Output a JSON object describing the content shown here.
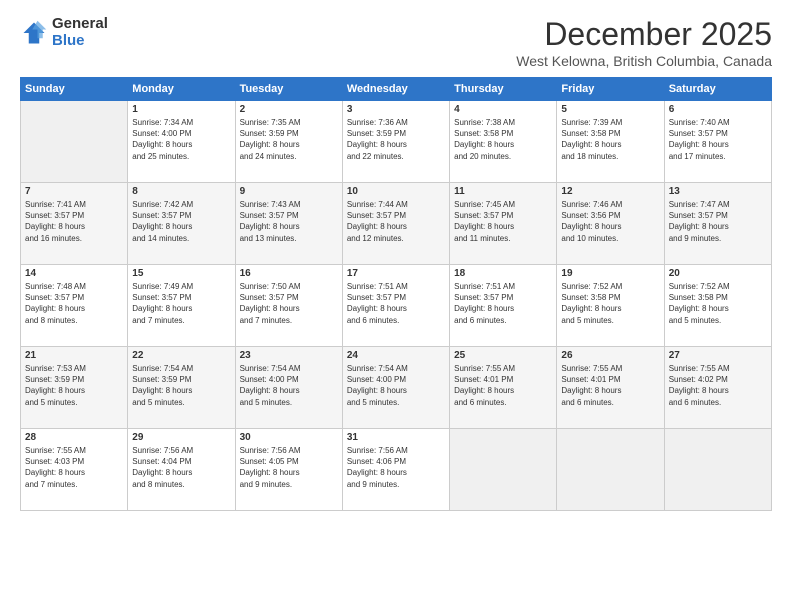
{
  "logo": {
    "general": "General",
    "blue": "Blue"
  },
  "header": {
    "month": "December 2025",
    "location": "West Kelowna, British Columbia, Canada"
  },
  "weekdays": [
    "Sunday",
    "Monday",
    "Tuesday",
    "Wednesday",
    "Thursday",
    "Friday",
    "Saturday"
  ],
  "weeks": [
    [
      {
        "day": "",
        "info": ""
      },
      {
        "day": "1",
        "info": "Sunrise: 7:34 AM\nSunset: 4:00 PM\nDaylight: 8 hours\nand 25 minutes."
      },
      {
        "day": "2",
        "info": "Sunrise: 7:35 AM\nSunset: 3:59 PM\nDaylight: 8 hours\nand 24 minutes."
      },
      {
        "day": "3",
        "info": "Sunrise: 7:36 AM\nSunset: 3:59 PM\nDaylight: 8 hours\nand 22 minutes."
      },
      {
        "day": "4",
        "info": "Sunrise: 7:38 AM\nSunset: 3:58 PM\nDaylight: 8 hours\nand 20 minutes."
      },
      {
        "day": "5",
        "info": "Sunrise: 7:39 AM\nSunset: 3:58 PM\nDaylight: 8 hours\nand 18 minutes."
      },
      {
        "day": "6",
        "info": "Sunrise: 7:40 AM\nSunset: 3:57 PM\nDaylight: 8 hours\nand 17 minutes."
      }
    ],
    [
      {
        "day": "7",
        "info": "Sunrise: 7:41 AM\nSunset: 3:57 PM\nDaylight: 8 hours\nand 16 minutes."
      },
      {
        "day": "8",
        "info": "Sunrise: 7:42 AM\nSunset: 3:57 PM\nDaylight: 8 hours\nand 14 minutes."
      },
      {
        "day": "9",
        "info": "Sunrise: 7:43 AM\nSunset: 3:57 PM\nDaylight: 8 hours\nand 13 minutes."
      },
      {
        "day": "10",
        "info": "Sunrise: 7:44 AM\nSunset: 3:57 PM\nDaylight: 8 hours\nand 12 minutes."
      },
      {
        "day": "11",
        "info": "Sunrise: 7:45 AM\nSunset: 3:57 PM\nDaylight: 8 hours\nand 11 minutes."
      },
      {
        "day": "12",
        "info": "Sunrise: 7:46 AM\nSunset: 3:56 PM\nDaylight: 8 hours\nand 10 minutes."
      },
      {
        "day": "13",
        "info": "Sunrise: 7:47 AM\nSunset: 3:57 PM\nDaylight: 8 hours\nand 9 minutes."
      }
    ],
    [
      {
        "day": "14",
        "info": "Sunrise: 7:48 AM\nSunset: 3:57 PM\nDaylight: 8 hours\nand 8 minutes."
      },
      {
        "day": "15",
        "info": "Sunrise: 7:49 AM\nSunset: 3:57 PM\nDaylight: 8 hours\nand 7 minutes."
      },
      {
        "day": "16",
        "info": "Sunrise: 7:50 AM\nSunset: 3:57 PM\nDaylight: 8 hours\nand 7 minutes."
      },
      {
        "day": "17",
        "info": "Sunrise: 7:51 AM\nSunset: 3:57 PM\nDaylight: 8 hours\nand 6 minutes."
      },
      {
        "day": "18",
        "info": "Sunrise: 7:51 AM\nSunset: 3:57 PM\nDaylight: 8 hours\nand 6 minutes."
      },
      {
        "day": "19",
        "info": "Sunrise: 7:52 AM\nSunset: 3:58 PM\nDaylight: 8 hours\nand 5 minutes."
      },
      {
        "day": "20",
        "info": "Sunrise: 7:52 AM\nSunset: 3:58 PM\nDaylight: 8 hours\nand 5 minutes."
      }
    ],
    [
      {
        "day": "21",
        "info": "Sunrise: 7:53 AM\nSunset: 3:59 PM\nDaylight: 8 hours\nand 5 minutes."
      },
      {
        "day": "22",
        "info": "Sunrise: 7:54 AM\nSunset: 3:59 PM\nDaylight: 8 hours\nand 5 minutes."
      },
      {
        "day": "23",
        "info": "Sunrise: 7:54 AM\nSunset: 4:00 PM\nDaylight: 8 hours\nand 5 minutes."
      },
      {
        "day": "24",
        "info": "Sunrise: 7:54 AM\nSunset: 4:00 PM\nDaylight: 8 hours\nand 5 minutes."
      },
      {
        "day": "25",
        "info": "Sunrise: 7:55 AM\nSunset: 4:01 PM\nDaylight: 8 hours\nand 6 minutes."
      },
      {
        "day": "26",
        "info": "Sunrise: 7:55 AM\nSunset: 4:01 PM\nDaylight: 8 hours\nand 6 minutes."
      },
      {
        "day": "27",
        "info": "Sunrise: 7:55 AM\nSunset: 4:02 PM\nDaylight: 8 hours\nand 6 minutes."
      }
    ],
    [
      {
        "day": "28",
        "info": "Sunrise: 7:55 AM\nSunset: 4:03 PM\nDaylight: 8 hours\nand 7 minutes."
      },
      {
        "day": "29",
        "info": "Sunrise: 7:56 AM\nSunset: 4:04 PM\nDaylight: 8 hours\nand 8 minutes."
      },
      {
        "day": "30",
        "info": "Sunrise: 7:56 AM\nSunset: 4:05 PM\nDaylight: 8 hours\nand 9 minutes."
      },
      {
        "day": "31",
        "info": "Sunrise: 7:56 AM\nSunset: 4:06 PM\nDaylight: 8 hours\nand 9 minutes."
      },
      {
        "day": "",
        "info": ""
      },
      {
        "day": "",
        "info": ""
      },
      {
        "day": "",
        "info": ""
      }
    ]
  ]
}
